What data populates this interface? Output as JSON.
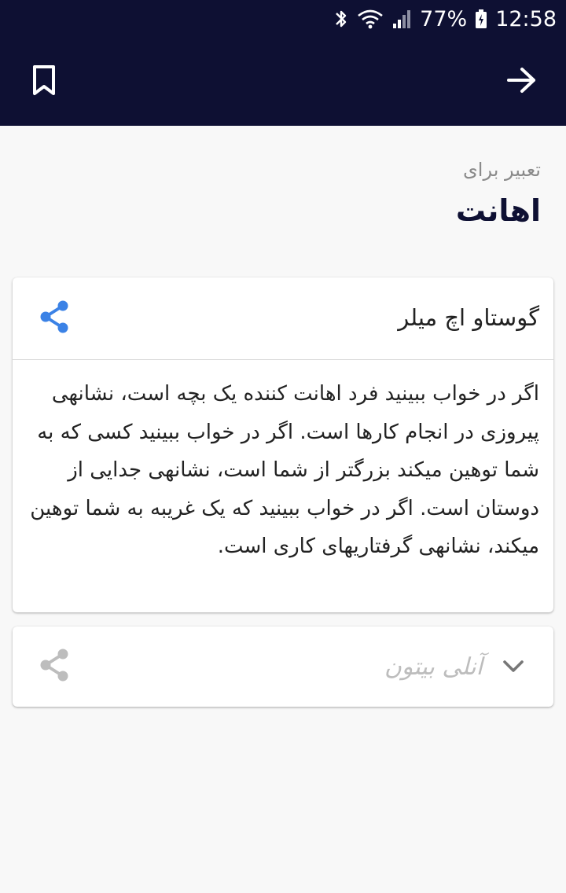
{
  "status_bar": {
    "battery": "77%",
    "time": "12:58",
    "icons": [
      "bluetooth-icon",
      "wifi-icon",
      "signal-icon",
      "battery-icon"
    ]
  },
  "toolbar": {
    "bookmark_icon": "bookmark-icon",
    "back_icon": "arrow-right-icon"
  },
  "page": {
    "subtitle": "تعبیر برای",
    "title": "اهانت"
  },
  "interpretations": [
    {
      "author": "گوستاو اچ میلر",
      "expanded": true,
      "text": "اگر در خواب ببینید فرد اهانت کننده یک بچه است، نشانهی پیروزی در انجام کارها است. اگر در خواب ببینید کسی که به شما توهین میکند بزرگتر از شما است، نشانهی جدایی از دوستان است. اگر در خواب ببینید که یک غریبه به شما توهین میکند، نشانهی گرفتاریهای کاری است.",
      "share_icon": "share-icon"
    },
    {
      "author": "آنلی بیتون",
      "expanded": false,
      "share_icon": "share-icon"
    }
  ],
  "colors": {
    "header": "#0e1033",
    "accent_share": "#3b82e6",
    "disabled": "#bdbdbd"
  }
}
